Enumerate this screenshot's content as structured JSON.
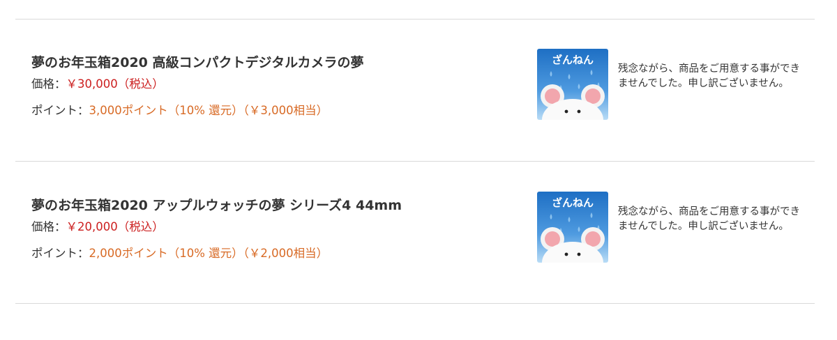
{
  "items": [
    {
      "title": "夢のお年玉箱2020 高級コンパクトデジタルカメラの夢",
      "price_label": "価格：",
      "price_value": "￥30,000（税込）",
      "points_label": "ポイント：",
      "points_value": "3,000ポイント（10% 還元）（￥3,000相当）",
      "image_text": "ざんねん",
      "message": "残念ながら、商品をご用意する事ができませんでした。申し訳ございません。"
    },
    {
      "title": "夢のお年玉箱2020 アップルウォッチの夢 シリーズ4 44mm",
      "price_label": "価格：",
      "price_value": "￥20,000（税込）",
      "points_label": "ポイント：",
      "points_value": "2,000ポイント（10% 還元）（￥2,000相当）",
      "image_text": "ざんねん",
      "message": "残念ながら、商品をご用意する事ができませんでした。申し訳ございません。"
    }
  ],
  "colors": {
    "price": "#cc2020",
    "points": "#d86a25",
    "image_blue": "#2f7fce"
  },
  "icons": {
    "sorry_image": "sad-mouse-icon"
  }
}
